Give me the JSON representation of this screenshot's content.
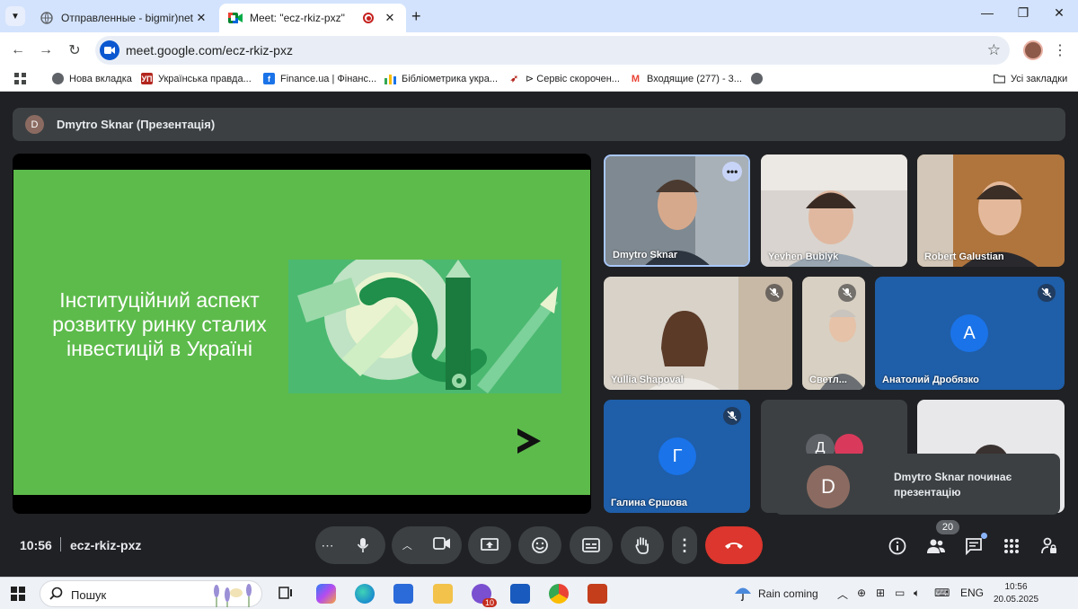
{
  "browser": {
    "tabs": [
      {
        "title": "Отправленные - bigmir)net",
        "active": false,
        "favicon": "globe-icon"
      },
      {
        "title": "Meet: \"ecz-rkiz-pxz\"",
        "active": true,
        "favicon": "meet-icon"
      }
    ],
    "url": "meet.google.com/ecz-rkiz-pxz",
    "bookmarks": [
      {
        "label": "Нова вкладка",
        "icon": "globe-icon"
      },
      {
        "label": "Українська правда...",
        "icon": "up-icon"
      },
      {
        "label": "Finance.ua | Фінанс...",
        "icon": "finance-icon"
      },
      {
        "label": "Бібліометрика укра...",
        "icon": "chart-icon"
      },
      {
        "label": "⊳ Сервіс скорочен...",
        "icon": "arrow-icon"
      },
      {
        "label": "Входящие (277) - 3...",
        "icon": "gmail-icon"
      }
    ],
    "all_bookmarks": "Усі закладки"
  },
  "meet": {
    "presenter_initial": "D",
    "presenter_label": "Dmytro Sknar (Презентація)",
    "slide_title": "Інституційний аспект розвитку ринку сталих інвестицій в Україні",
    "participants": [
      {
        "name": "Dmytro Sknar"
      },
      {
        "name": "Yevhen Bublyk"
      },
      {
        "name": "Robert Galustian"
      },
      {
        "name": "Yullia Shapoval"
      },
      {
        "name": "Светл..."
      },
      {
        "name": "Анатолий Дробязко",
        "initial": "A"
      },
      {
        "name": "Галина Єршова",
        "initial": "Г"
      },
      {
        "initial": "Д"
      }
    ],
    "toast_initial": "D",
    "toast_text": "Dmytro Sknar починає презентацію",
    "time": "10:56",
    "meeting_code": "ecz-rkiz-pxz",
    "participants_count": "20"
  },
  "taskbar": {
    "search_label": "Пошук",
    "weather": "Rain coming",
    "language": "ENG",
    "clock_time": "10:56",
    "clock_date": "20.05.2025",
    "chat_badge": "10"
  },
  "colors": {
    "slide_green": "#5dbb4b",
    "end_call_red": "#dc362e",
    "meet_bg": "#202124",
    "tile_blue": "#1f5ea8"
  }
}
